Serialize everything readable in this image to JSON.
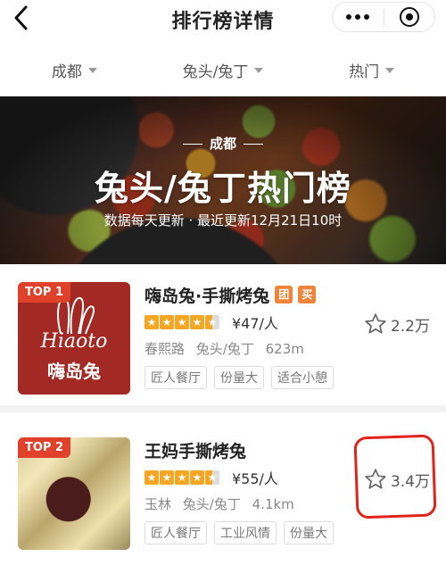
{
  "header": {
    "title": "排行榜详情",
    "back_icon": "chevron-left-icon",
    "more_icon": "more-dots-icon",
    "target_icon": "target-icon"
  },
  "filters": [
    {
      "label": "成都"
    },
    {
      "label": "兔头/兔丁"
    },
    {
      "label": "热门"
    }
  ],
  "banner": {
    "city": "成都",
    "headline": "兔头/兔丁热门榜",
    "subline": "数据每天更新 · 最近更新12月21日10时"
  },
  "items": [
    {
      "rank": "TOP 1",
      "name": "嗨岛兔·手撕烤兔",
      "badges": [
        "团",
        "买"
      ],
      "rating": 4.5,
      "price": "¥47/人",
      "area": "春熙路",
      "category": "兔头/兔丁",
      "distance": "623m",
      "tags": [
        "匠人餐厅",
        "份量大",
        "适合小憩"
      ],
      "favorites": "2.2万",
      "logo_text": "Hiaoto",
      "logo_cn": "嗨岛兔"
    },
    {
      "rank": "TOP 2",
      "name": "王妈手撕烤兔",
      "badges": [],
      "rating": 4.5,
      "price": "¥55/人",
      "area": "玉林",
      "category": "兔头/兔丁",
      "distance": "4.1km",
      "tags": [
        "匠人餐厅",
        "工业风情",
        "份量大"
      ],
      "favorites": "3.4万"
    }
  ],
  "colors": {
    "accent_red": "#e0412a",
    "star": "#f5a623",
    "annotation_red": "#e0241a"
  }
}
